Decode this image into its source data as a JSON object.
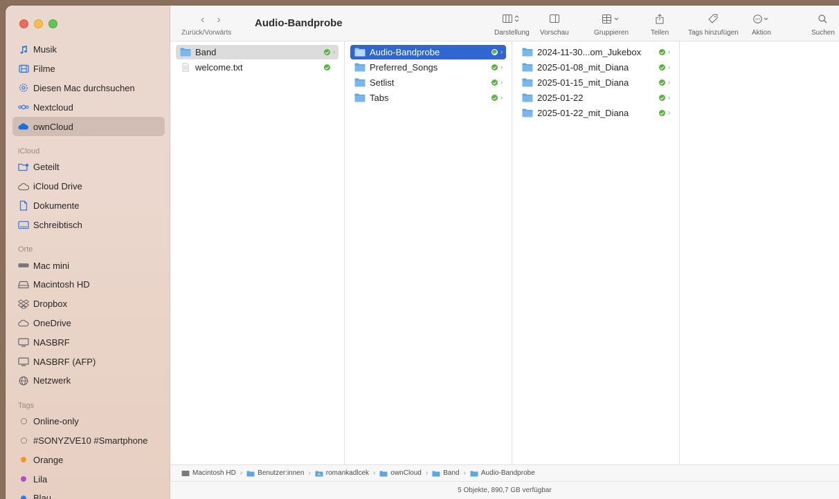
{
  "window": {
    "title": "Audio-Bandprobe"
  },
  "toolbar": {
    "nav_caption": "Zurück/Vorwärts",
    "back_glyph": "‹",
    "forward_glyph": "›",
    "buttons": [
      {
        "label": "Darstellung",
        "icon": "columns-view-icon"
      },
      {
        "label": "Vorschau",
        "icon": "preview-icon"
      },
      {
        "label": "Gruppieren",
        "icon": "group-icon"
      },
      {
        "label": "Teilen",
        "icon": "share-icon"
      },
      {
        "label": "Tags hinzufügen",
        "icon": "tag-icon"
      },
      {
        "label": "Aktion",
        "icon": "action-icon"
      },
      {
        "label": "Suchen",
        "icon": "search-icon"
      }
    ]
  },
  "sidebar": {
    "top_items": [
      {
        "label": "Musik",
        "icon": "music-icon"
      },
      {
        "label": "Filme",
        "icon": "film-icon"
      },
      {
        "label": "Diesen Mac durchsuchen",
        "icon": "gear-icon"
      },
      {
        "label": "Nextcloud",
        "icon": "nextcloud-icon"
      },
      {
        "label": "ownCloud",
        "icon": "cloud-icon"
      }
    ],
    "icloud_heading": "iCloud",
    "icloud_items": [
      {
        "label": "Geteilt",
        "icon": "shared-folder-icon"
      },
      {
        "label": "iCloud Drive",
        "icon": "cloud-outline-icon"
      },
      {
        "label": "Dokumente",
        "icon": "document-icon"
      },
      {
        "label": "Schreibtisch",
        "icon": "desktop-icon"
      }
    ],
    "locations_heading": "Orte",
    "location_items": [
      {
        "label": "Mac mini",
        "icon": "mac-mini-icon"
      },
      {
        "label": "Macintosh HD",
        "icon": "hard-drive-icon"
      },
      {
        "label": "Dropbox",
        "icon": "dropbox-icon"
      },
      {
        "label": "OneDrive",
        "icon": "onedrive-icon"
      },
      {
        "label": "NASBRF",
        "icon": "network-drive-icon"
      },
      {
        "label": "NASBRF (AFP)",
        "icon": "network-drive-icon"
      },
      {
        "label": "Netzwerk",
        "icon": "network-icon"
      }
    ],
    "tags_heading": "Tags",
    "tag_items": [
      {
        "label": "Online-only",
        "color": ""
      },
      {
        "label": "#SONYZVE10 #Smartphone",
        "color": ""
      },
      {
        "label": "Orange",
        "color": "#f39a1e"
      },
      {
        "label": "Lila",
        "color": "#b14fcf"
      },
      {
        "label": "Blau",
        "color": "#2c7bf0"
      }
    ]
  },
  "columns": {
    "col1": [
      {
        "name": "Band",
        "type": "folder"
      },
      {
        "name": "welcome.txt",
        "type": "file"
      }
    ],
    "col2": [
      {
        "name": "Audio-Bandprobe",
        "type": "folder"
      },
      {
        "name": "Preferred_Songs",
        "type": "folder"
      },
      {
        "name": "Setlist",
        "type": "folder"
      },
      {
        "name": "Tabs",
        "type": "folder"
      }
    ],
    "col3": [
      {
        "name": "2024-11-30...om_Jukebox",
        "type": "folder"
      },
      {
        "name": "2025-01-08_mit_Diana",
        "type": "folder"
      },
      {
        "name": "2025-01-15_mit_Diana",
        "type": "folder"
      },
      {
        "name": "2025-01-22",
        "type": "folder"
      },
      {
        "name": "2025-01-22_mit_Diana",
        "type": "folder"
      }
    ]
  },
  "pathbar": [
    {
      "label": "Macintosh HD",
      "icon": "hard-drive-icon"
    },
    {
      "label": "Benutzer:innen",
      "icon": "folder-icon"
    },
    {
      "label": "romankadlcek",
      "icon": "home-folder-icon"
    },
    {
      "label": "ownCloud",
      "icon": "folder-icon"
    },
    {
      "label": "Band",
      "icon": "folder-icon"
    },
    {
      "label": "Audio-Bandprobe",
      "icon": "folder-icon"
    }
  ],
  "statusbar": {
    "text": "5 Objekte, 890,7 GB verfügbar"
  },
  "colors": {
    "selection_blue": "#2f66d0",
    "folder_blue": "#5aa6e6",
    "sync_green": "#56b53b"
  }
}
